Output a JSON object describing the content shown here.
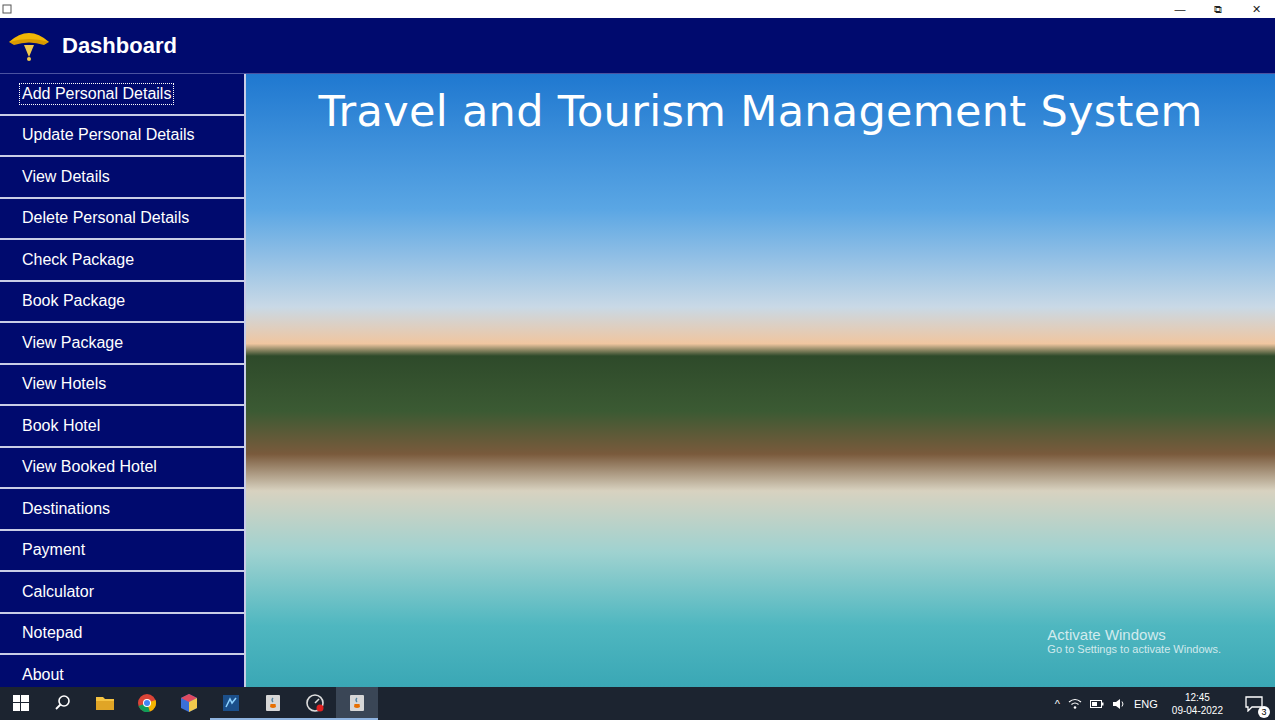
{
  "window": {
    "controls": [
      "—",
      "⧉",
      "✕"
    ]
  },
  "header": {
    "title": "Dashboard"
  },
  "sidebar": {
    "items": [
      {
        "label": "Add Personal Details",
        "selected": true
      },
      {
        "label": "Update Personal Details",
        "selected": false
      },
      {
        "label": "View Details",
        "selected": false
      },
      {
        "label": "Delete Personal Details",
        "selected": false
      },
      {
        "label": "Check Package",
        "selected": false
      },
      {
        "label": "Book Package",
        "selected": false
      },
      {
        "label": "View Package",
        "selected": false
      },
      {
        "label": "View Hotels",
        "selected": false
      },
      {
        "label": "Book Hotel",
        "selected": false
      },
      {
        "label": "View Booked Hotel",
        "selected": false
      },
      {
        "label": "Destinations",
        "selected": false
      },
      {
        "label": "Payment",
        "selected": false
      },
      {
        "label": "Calculator",
        "selected": false
      },
      {
        "label": "Notepad",
        "selected": false
      },
      {
        "label": "About",
        "selected": false
      }
    ]
  },
  "hero": {
    "title": "Travel and Tourism Management System"
  },
  "watermark": {
    "title": "Activate Windows",
    "subtitle": "Go to Settings to activate Windows."
  },
  "taskbar": {
    "apps": [
      {
        "kind": "explorer",
        "running": false,
        "selected": false
      },
      {
        "kind": "chrome",
        "running": false,
        "selected": false
      },
      {
        "kind": "cube",
        "running": false,
        "selected": false
      },
      {
        "kind": "ide",
        "running": true,
        "selected": false
      },
      {
        "kind": "java",
        "running": true,
        "selected": false
      },
      {
        "kind": "recorder",
        "running": true,
        "selected": false
      },
      {
        "kind": "java",
        "running": true,
        "selected": true
      }
    ],
    "tray": {
      "chevron": "^",
      "language": "ENG",
      "time": "12:45",
      "date": "09-04-2022",
      "notifications": "3"
    }
  }
}
